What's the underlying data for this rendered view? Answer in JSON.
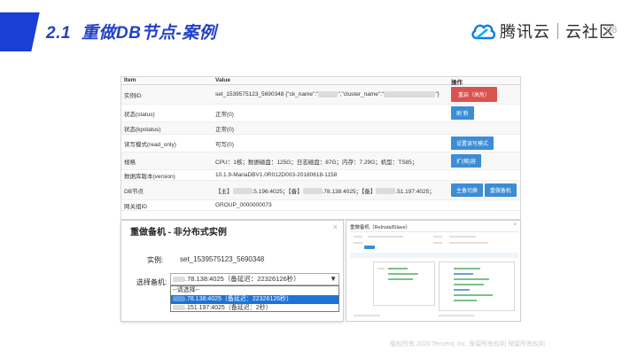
{
  "header": {
    "section_number": "2.1",
    "title": "重做DB节点-案例",
    "logo_brand": "腾讯云",
    "logo_sub": "云社区",
    "page_number": "08",
    "brand_color": "#1a3fd6"
  },
  "table": {
    "columns": [
      "Item",
      "Value",
      "操作"
    ],
    "rows": [
      {
        "item": "实例ID",
        "value": "set_1539575123_5690348 {\"ck_name\":\"",
        "value2": "\",\"cluster_name\":\"",
        "value3": "\"}",
        "actions": [
          "重启（高危）"
        ]
      },
      {
        "item": "状态(status)",
        "value": "正常(0)",
        "actions": [
          "刷 新"
        ]
      },
      {
        "item": "状态(kpstatus)",
        "value": "正常(0)",
        "actions": []
      },
      {
        "item": "读写模式(read_only)",
        "value": "可写(0)",
        "actions": [
          "设置读写模式"
        ]
      },
      {
        "item": "规格",
        "value": "CPU：1核；数据磁盘：125G；日志磁盘：87G；内存：7.29G；机型：TS85；",
        "actions": [
          "扩(缩)容"
        ]
      },
      {
        "item": "数据库版本(version)",
        "value": "10.1.9-MariaDBV1.0R012D003-20180618-1158",
        "actions": []
      },
      {
        "item": "DB节点",
        "value_parts": [
          "【主】",
          ".5.196:4025；【备】",
          ".78.138:4025；【备】",
          ".51.197:4025；"
        ],
        "actions": [
          "主备切换",
          "重做备机"
        ]
      },
      {
        "item": "网关组ID",
        "value": "GROUP_0000000073",
        "actions": []
      }
    ]
  },
  "dialog": {
    "title": "重做备机 - 非分布式实例",
    "close": "×",
    "instance_label": "实例:",
    "instance_value": "set_1539575123_5690348",
    "select_label": "选择备机:",
    "select_value": ".78.138:4025（备延迟：22326126秒）",
    "options": [
      "--请选择--",
      ".78.138:4025（备延迟：22326126秒）",
      ".151.197:4025（备延迟：2秒）"
    ],
    "selected_index": 1
  },
  "screenshot": {
    "title": "重做备机（ReInstallSlave）",
    "close": "×"
  },
  "footer": {
    "text": "版权所有 2020 Tencent, Inc. 保留所有权利 保留所有权利"
  }
}
